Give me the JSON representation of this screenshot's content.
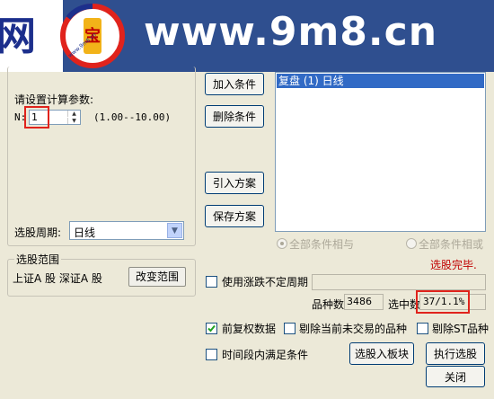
{
  "banner": {
    "site_char": "网",
    "logo_text": "www.9m8.cn",
    "url_text": "www.9m8.cn"
  },
  "params": {
    "label": "请设置计算参数:",
    "n_label": "N:",
    "n_value": "1",
    "n_range": "(1.00--10.00)"
  },
  "period": {
    "label": "选股周期:",
    "value": "日线"
  },
  "range": {
    "legend": "选股范围",
    "value": "上证A 股 深证A 股",
    "change_button": "改变范围"
  },
  "buttons": {
    "add_condition": "加入条件",
    "delete_condition": "删除条件",
    "import_plan": "引入方案",
    "save_plan": "保存方案",
    "select_to_block": "选股入板块",
    "execute": "执行选股",
    "close": "关闭"
  },
  "conditions": {
    "items": [
      "复盘 (1) 日线"
    ],
    "logic_and": "全部条件相与",
    "logic_or": "全部条件相或",
    "status": "选股完毕."
  },
  "uncertain_period": {
    "label": "使用涨跌不定周期"
  },
  "stats": {
    "count_label": "品种数",
    "count_value": "3486",
    "selected_label": "选中数",
    "selected_value": "37/1.1%"
  },
  "options": {
    "forward_adjust": "前复权数据",
    "forward_adjust_checked": true,
    "exclude_untraded": "剔除当前未交易的品种",
    "exclude_untraded_checked": false,
    "exclude_st": "剔除ST品种",
    "exclude_st_checked": false,
    "time_range": "时间段内满足条件",
    "time_range_checked": false
  },
  "colors": {
    "window_bg": "#ece9d8",
    "selection": "#316ac5",
    "status_red": "#c00000",
    "highlight_red": "#e0231c"
  }
}
